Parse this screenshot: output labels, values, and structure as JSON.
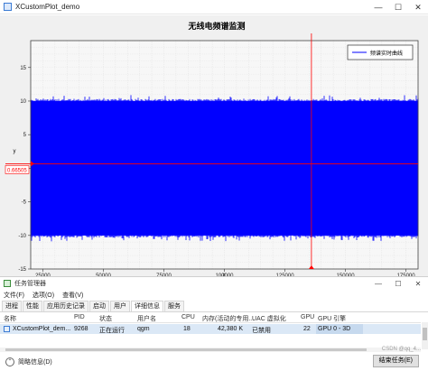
{
  "window": {
    "title": "XCustomPlot_demo",
    "controls": {
      "minimize": "—",
      "maximize": "☐",
      "close": "✕"
    }
  },
  "chart_data": {
    "type": "line",
    "title": "无线电频谱监测",
    "xlabel": "x",
    "ylabel": "y",
    "xlim": [
      20000,
      180000
    ],
    "ylim": [
      -15,
      19
    ],
    "x_ticks": [
      "25000",
      "50000",
      "75000",
      "100000",
      "125000",
      "150000",
      "175000"
    ],
    "y_ticks": [
      "15",
      "10",
      "5",
      "0",
      "-5",
      "-10",
      "-15"
    ],
    "grid": true,
    "legend": {
      "position": "top-right",
      "entries": [
        "频谱实时曲线"
      ]
    },
    "series": [
      {
        "name": "频谱实时曲线",
        "color": "#0000ff",
        "x_range": [
          20000,
          180000
        ],
        "y_band": [
          -10,
          10
        ],
        "noise_amplitude": 10
      }
    ],
    "cursor": {
      "x": 135953,
      "y": 0.665,
      "x_label": "135953",
      "y_label": "0.66505",
      "color": "#ff0000"
    }
  },
  "task_manager": {
    "title": "任务管理器",
    "controls": {
      "minimize": "—",
      "maximize": "☐",
      "close": "✕"
    },
    "menu": [
      "文件(F)",
      "选项(O)",
      "查看(V)"
    ],
    "tabs": [
      "进程",
      "性能",
      "应用历史记录",
      "启动",
      "用户",
      "详细信息",
      "服务"
    ],
    "active_tab": "详细信息",
    "columns": [
      "名称",
      "PID",
      "状态",
      "用户名",
      "CPU",
      "内存(活动的专用...",
      "UAC 虚拟化",
      "GPU",
      "GPU 引擎"
    ],
    "rows": [
      {
        "name": "XCustomPlot_dem...",
        "pid": "9268",
        "status": "正在运行",
        "user": "qgm",
        "cpu": "18",
        "memory": "42,380 K",
        "uac": "已禁用",
        "gpu": "22",
        "gpu_engine": "GPU 0 - 3D"
      }
    ],
    "footer": {
      "summary": "简略信息(D)",
      "end_task": "结束任务(E)",
      "watermark": "CSDN @qq_4..."
    }
  }
}
